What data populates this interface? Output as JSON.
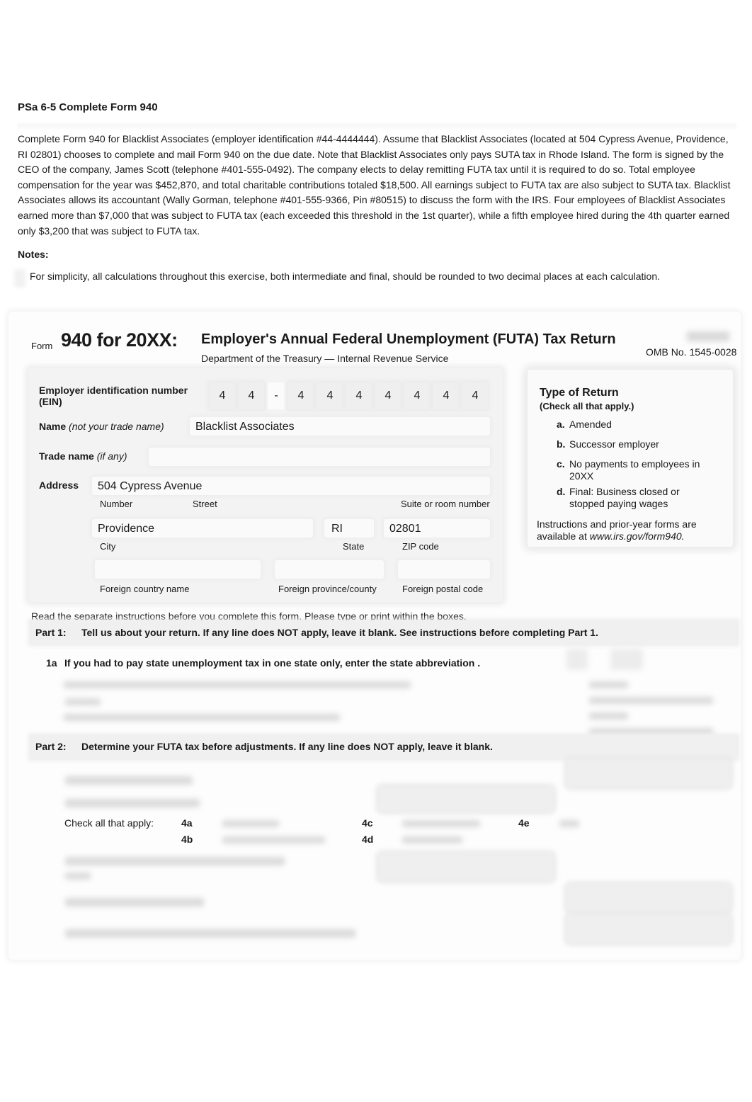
{
  "page": {
    "title": "PSa 6-5 Complete Form 940",
    "intro": "Complete Form 940 for Blacklist Associates (employer identification #44-4444444). Assume that Blacklist Associates (located at 504 Cypress Avenue, Providence, RI 02801) chooses to complete and mail Form 940 on the due date. Note that Blacklist Associates only pays SUTA tax in Rhode Island. The form is signed by the CEO of the company, James Scott (telephone #401-555-0492). The company elects to delay remitting FUTA tax until it is required to do so. Total employee compensation for the year was $452,870, and total charitable contributions totaled $18,500. All earnings subject to FUTA tax are also subject to SUTA tax. Blacklist Associates allows its accountant (Wally Gorman, telephone #401-555-9366, Pin #80515) to discuss the form with the IRS. Four employees of Blacklist Associates earned more than $7,000 that was subject to FUTA tax (each exceeded this threshold in the 1st quarter), while a fifth employee hired during the 4th quarter earned only $3,200 that was subject to FUTA tax.",
    "notes_heading": "Notes:",
    "note": "For simplicity, all calculations throughout this exercise, both intermediate and final, should be rounded to two decimal places at each calculation."
  },
  "form": {
    "form_label": "Form",
    "form_number": "940 for 20XX:",
    "heading": "Employer's Annual Federal Unemployment (FUTA) Tax Return",
    "subheading": "Department of the Treasury — Internal Revenue Service",
    "omb": "OMB No. 1545-0028",
    "ein_label": "Employer identification number (EIN)",
    "ein_digits": [
      "4",
      "4",
      "4",
      "4",
      "4",
      "4",
      "4",
      "4",
      "4"
    ],
    "ein_separator": "-",
    "name_label": "Name",
    "name_hint": "(not your trade name)",
    "name_value": "Blacklist Associates",
    "trade_label": "Trade name",
    "trade_hint": "(if any)",
    "trade_value": "",
    "address_label": "Address",
    "street_value": "504 Cypress Avenue",
    "cap_number": "Number",
    "cap_street": "Street",
    "cap_suite": "Suite or room number",
    "city_value": "Providence",
    "state_value": "RI",
    "zip_value": "02801",
    "cap_city": "City",
    "cap_state": "State",
    "cap_zip": "ZIP code",
    "cap_foreign_country": "Foreign country name",
    "cap_foreign_province": "Foreign province/county",
    "cap_foreign_postal": "Foreign postal code",
    "type_of_return": {
      "title": "Type of Return",
      "subtitle": "(Check all that apply.)",
      "items": [
        {
          "code": "a.",
          "label": "Amended"
        },
        {
          "code": "b.",
          "label": "Successor employer"
        },
        {
          "code": "c.",
          "label": "No payments to employees in 20XX"
        },
        {
          "code": "d.",
          "label": "Final: Business closed or stopped paying wages"
        }
      ],
      "footer_text": "Instructions and prior-year forms are available at ",
      "footer_link": "www.irs.gov/form940."
    },
    "read_note": "Read the separate instructions before you complete this form. Please type or print within the boxes.",
    "part1": {
      "label": "Part 1:",
      "text": "Tell us about your return. If any line does NOT apply, leave it blank. See instructions before completing Part 1.",
      "line_1a_code": "1a",
      "line_1a_text": "If you had to pay state unemployment tax in one state only, enter the state abbreviation ."
    },
    "part2": {
      "label": "Part 2:",
      "text": "Determine your FUTA tax before adjustments. If any line does NOT apply, leave it blank.",
      "check_all_label": "Check all that apply:",
      "check_codes": [
        "4a",
        "4b",
        "4c",
        "4d",
        "4e"
      ]
    }
  }
}
